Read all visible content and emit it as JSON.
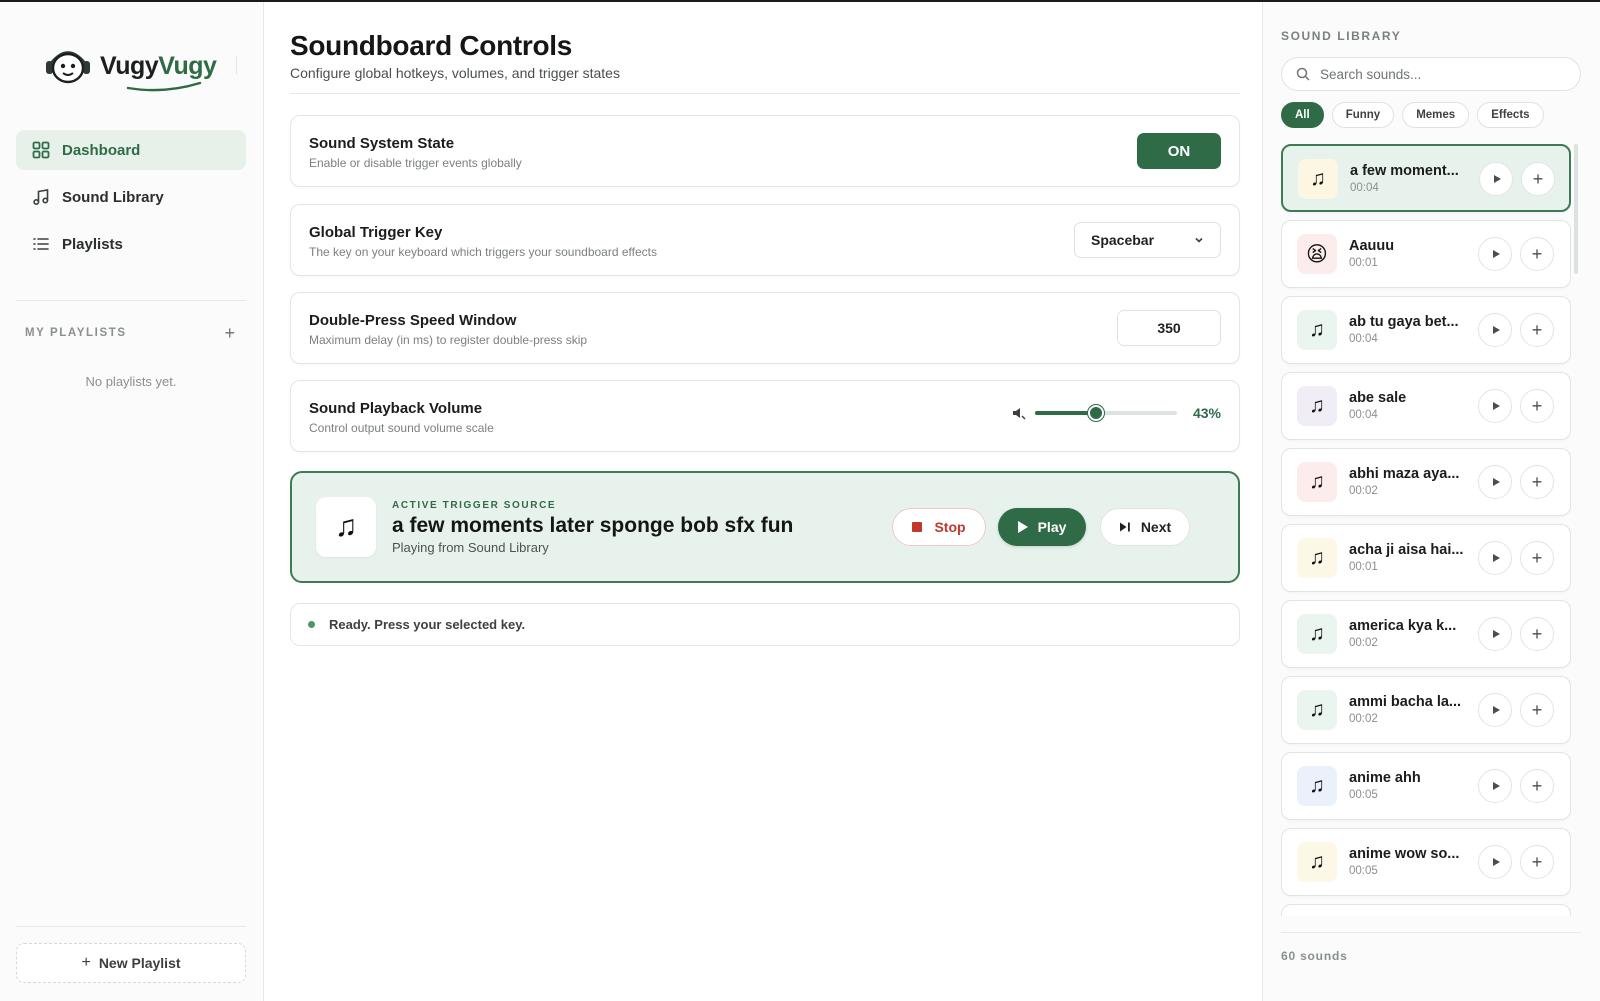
{
  "app": {
    "brand_a": "Vugy",
    "brand_b": "Vugy"
  },
  "colors": {
    "accent": "#2f6b46",
    "accent_bg": "#e8f2ec",
    "stop": "#c0392b"
  },
  "sidebar": {
    "nav": [
      {
        "label": "Dashboard",
        "icon": "grid-icon",
        "active": true
      },
      {
        "label": "Sound Library",
        "icon": "music-note-icon",
        "active": false
      },
      {
        "label": "Playlists",
        "icon": "list-icon",
        "active": false
      }
    ],
    "my_playlists_label": "MY PLAYLISTS",
    "add_playlist_glyph": "+",
    "empty_text": "No playlists yet.",
    "new_playlist_label": "New Playlist"
  },
  "main": {
    "title": "Soundboard Controls",
    "subtitle": "Configure global hotkeys, volumes, and trigger states",
    "system_state": {
      "title": "Sound System State",
      "desc": "Enable or disable trigger events globally",
      "toggle_label": "ON"
    },
    "trigger_key": {
      "title": "Global Trigger Key",
      "desc": "The key on your keyboard which triggers your soundboard effects",
      "selected": "Spacebar"
    },
    "double_press": {
      "title": "Double-Press Speed Window",
      "desc": "Maximum delay (in ms) to register double-press skip",
      "value": "350"
    },
    "volume": {
      "title": "Sound Playback Volume",
      "desc": "Control output sound volume scale",
      "level": 0.43,
      "display": "43%"
    },
    "active_trigger": {
      "kicker": "ACTIVE TRIGGER SOURCE",
      "name": "a few moments later sponge bob sfx fun",
      "source": "Playing from Sound Library",
      "art": "♫",
      "stop_label": "Stop",
      "play_label": "Play",
      "next_label": "Next"
    },
    "status_text": "Ready. Press your selected key."
  },
  "library": {
    "title": "SOUND LIBRARY",
    "search_placeholder": "Search sounds...",
    "filters": [
      "All",
      "Funny",
      "Memes",
      "Effects"
    ],
    "active_filter": "All",
    "sounds": [
      {
        "name": "a few moment...",
        "duration": "00:04",
        "icon": "♫",
        "tint": "#fdf6e3",
        "active": true
      },
      {
        "name": "Aauuu",
        "duration": "00:01",
        "icon": "😫",
        "tint": "#fcecec",
        "active": false
      },
      {
        "name": "ab tu gaya bet...",
        "duration": "00:04",
        "icon": "♫",
        "tint": "#e9f5ee",
        "active": false
      },
      {
        "name": "abe sale",
        "duration": "00:04",
        "icon": "♫",
        "tint": "#f1edf7",
        "active": false
      },
      {
        "name": "abhi maza aya...",
        "duration": "00:02",
        "icon": "♫",
        "tint": "#fcecec",
        "active": false
      },
      {
        "name": "acha ji aisa hai...",
        "duration": "00:01",
        "icon": "♫",
        "tint": "#fdf8e6",
        "active": false
      },
      {
        "name": "america kya k...",
        "duration": "00:02",
        "icon": "♫",
        "tint": "#e9f5ee",
        "active": false
      },
      {
        "name": "ammi bacha la...",
        "duration": "00:02",
        "icon": "♫",
        "tint": "#e9f5ee",
        "active": false
      },
      {
        "name": "anime ahh",
        "duration": "00:05",
        "icon": "♫",
        "tint": "#eaf1fa",
        "active": false
      },
      {
        "name": "anime wow so...",
        "duration": "00:05",
        "icon": "♫",
        "tint": "#fdf8e6",
        "active": false
      },
      {
        "name": "",
        "duration": "",
        "icon": "",
        "tint": "#ffffff",
        "active": false
      }
    ],
    "count_text": "60 sounds"
  }
}
